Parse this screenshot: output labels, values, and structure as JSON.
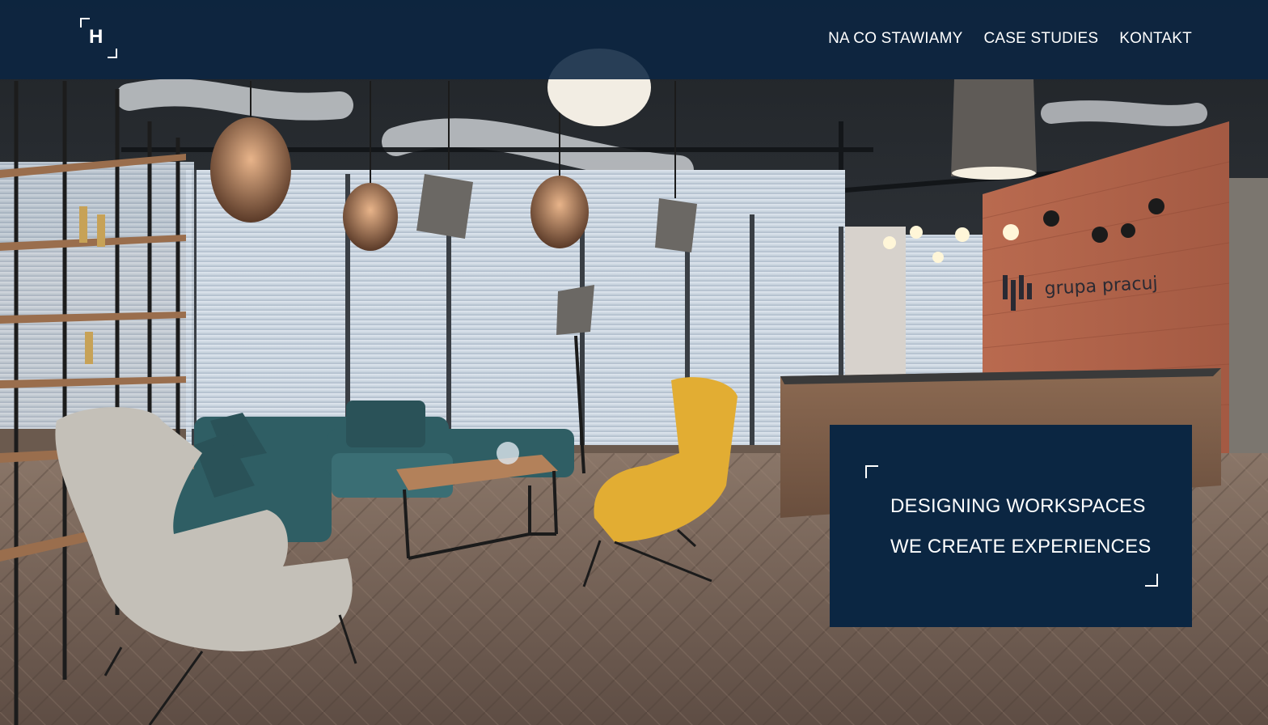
{
  "header": {
    "logo_letter": "H",
    "nav": [
      {
        "label": "NA CO STAWIAMY"
      },
      {
        "label": "CASE STUDIES"
      },
      {
        "label": "KONTAKT"
      }
    ]
  },
  "hero": {
    "sign_text": "grupa pracuj",
    "tagline": {
      "line1": "DESIGNING WORKSPACES",
      "line2": "WE CREATE EXPERIENCES"
    }
  },
  "colors": {
    "header_bg": "#0b2642",
    "card_bg": "#0b2642",
    "text": "#ffffff"
  }
}
